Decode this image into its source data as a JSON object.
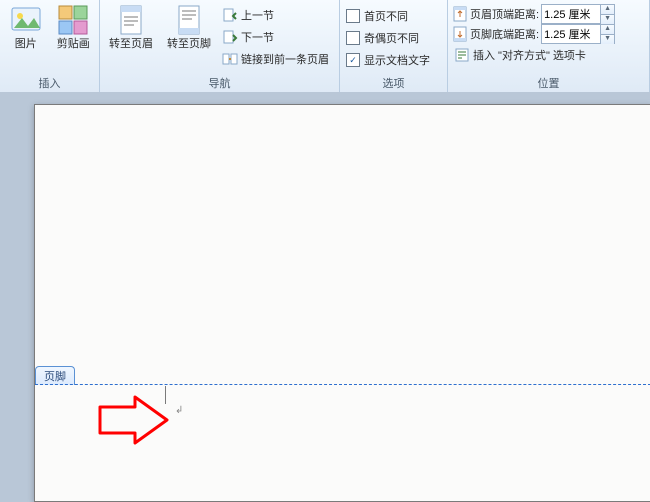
{
  "ribbon": {
    "insert": {
      "title": "插入",
      "picture": "图片",
      "clipart": "剪贴画"
    },
    "nav": {
      "title": "导航",
      "goto_header": "转至页眉",
      "goto_footer": "转至页脚",
      "prev": "上一节",
      "next": "下一节",
      "link_prev": "链接到前一条页眉"
    },
    "options": {
      "title": "选项",
      "diff_first": "首页不同",
      "diff_oddeven": "奇偶页不同",
      "show_text": "显示文档文字",
      "show_text_checked": "✓"
    },
    "position": {
      "title": "位置",
      "header_dist": "页眉顶端距离:",
      "footer_dist": "页脚底端距离:",
      "header_val": "1.25 厘米",
      "footer_val": "1.25 厘米",
      "align_tab": "插入 \"对齐方式\" 选项卡"
    }
  },
  "footer_tab": "页脚",
  "para_mark": "↲"
}
